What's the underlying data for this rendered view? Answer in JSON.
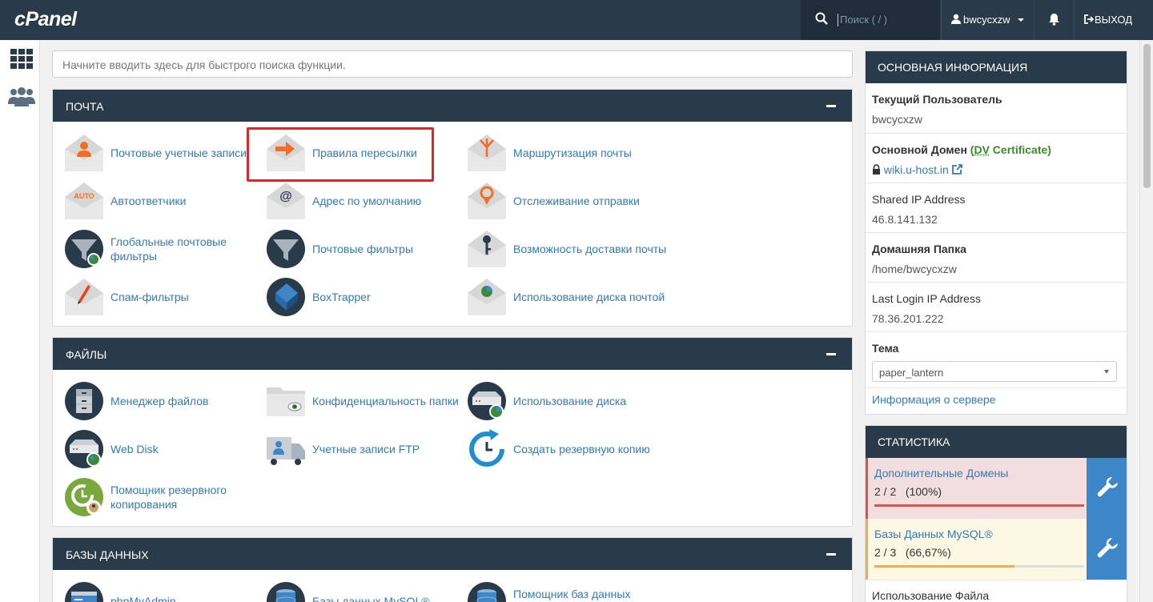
{
  "topbar": {
    "logo": "cPanel",
    "search_placeholder": "Поиск ( / )",
    "username": "bwcycxzw",
    "logout": "ВЫХОД"
  },
  "search": {
    "placeholder": "Начните вводить здесь для быстрого поиска функции."
  },
  "sections": {
    "mail": {
      "title": "ПОЧТА",
      "items": [
        "Почтовые учетные записи",
        "Правила пересылки",
        "Маршрутизация почты",
        "Автоответчики",
        "Адрес по умолчанию",
        "Отслеживание отправки",
        "Глобальные почтовые фильтры",
        "Почтовые фильтры",
        "Возможность доставки почты",
        "Спам-фильтры",
        "BoxTrapper",
        "Использование диска почтой"
      ]
    },
    "files": {
      "title": "ФАЙЛЫ",
      "items": [
        "Менеджер файлов",
        "Конфиденциальность папки",
        "Использование диска",
        "Web Disk",
        "Учетные записи FTP",
        "Создать резервную копию",
        "Помощник резервного копирования"
      ]
    },
    "databases": {
      "title": "БАЗЫ ДАННЫХ",
      "items": [
        "phpMyAdmin",
        "Базы данных MySQL®",
        "Помощник баз данных MySQL®"
      ]
    }
  },
  "general_info": {
    "title": "ОСНОВНАЯ ИНФОРМАЦИЯ",
    "current_user_label": "Текущий Пользователь",
    "current_user": "bwcycxzw",
    "primary_domain_label": "Основной Домен",
    "cert_open": "(",
    "cert_dv": "DV",
    "cert_rest": " Certificate)",
    "primary_domain": "wiki.u-host.in",
    "shared_ip_label": "Shared IP Address",
    "shared_ip": "46.8.141.132",
    "home_label": "Домашняя Папка",
    "home": "/home/bwcycxzw",
    "last_login_label": "Last Login IP Address",
    "last_login": "78.36.201.222",
    "theme_label": "Тема",
    "theme": "paper_lantern",
    "server_info": "Информация о сервере"
  },
  "stats": {
    "title": "СТАТИСТИКА",
    "rows": [
      {
        "label": "Дополнительные Домены",
        "value": "2 / 2",
        "pct_text": "(100%)",
        "fraction": 1.0,
        "color": "#d9534f",
        "bg": "#f2dede"
      },
      {
        "label": "Базы Данных MySQL®",
        "value": "2 / 3",
        "pct_text": "(66,67%)",
        "fraction": 0.6667,
        "color": "#f0ad4e",
        "bg": "#fcf8e3"
      }
    ],
    "next_label": "Использование Файла"
  }
}
